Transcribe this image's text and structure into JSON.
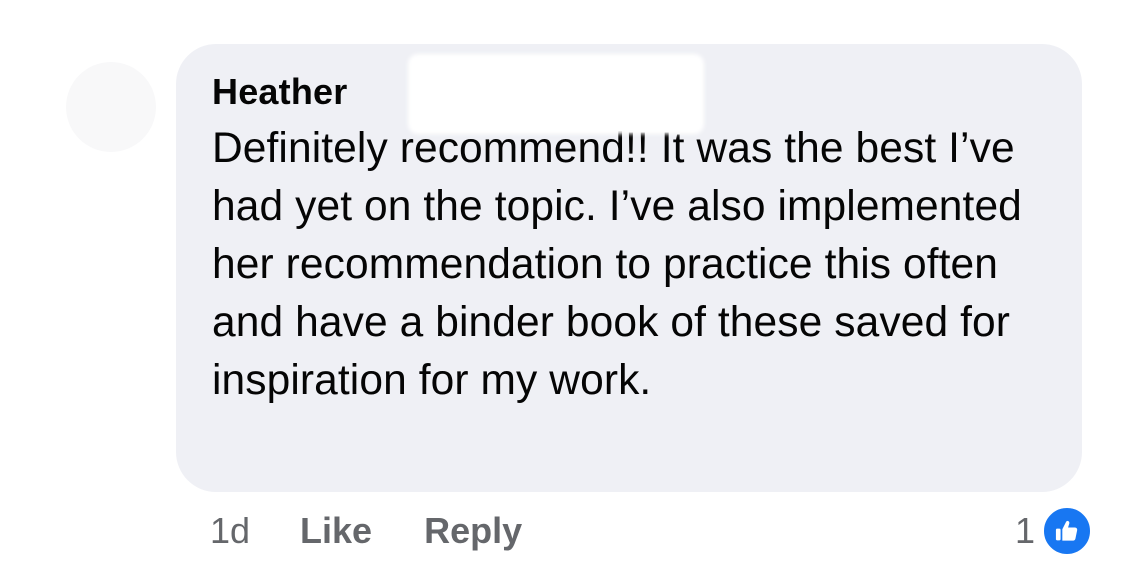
{
  "comment": {
    "author": "Heather",
    "text": "Definitely recommend!! It was the best I’ve had yet on the topic. I’ve also implemented her recommendation to practice this often and have a binder book of these saved for inspiration for my work."
  },
  "actions": {
    "time": "1d",
    "like_label": "Like",
    "reply_label": "Reply"
  },
  "reactions": {
    "count": "1",
    "icon": "thumbs-up-icon",
    "color": "#1877f2"
  },
  "colors": {
    "bubble_bg": "#eff0f5",
    "text": "#050505",
    "secondary_text": "#65676b"
  }
}
